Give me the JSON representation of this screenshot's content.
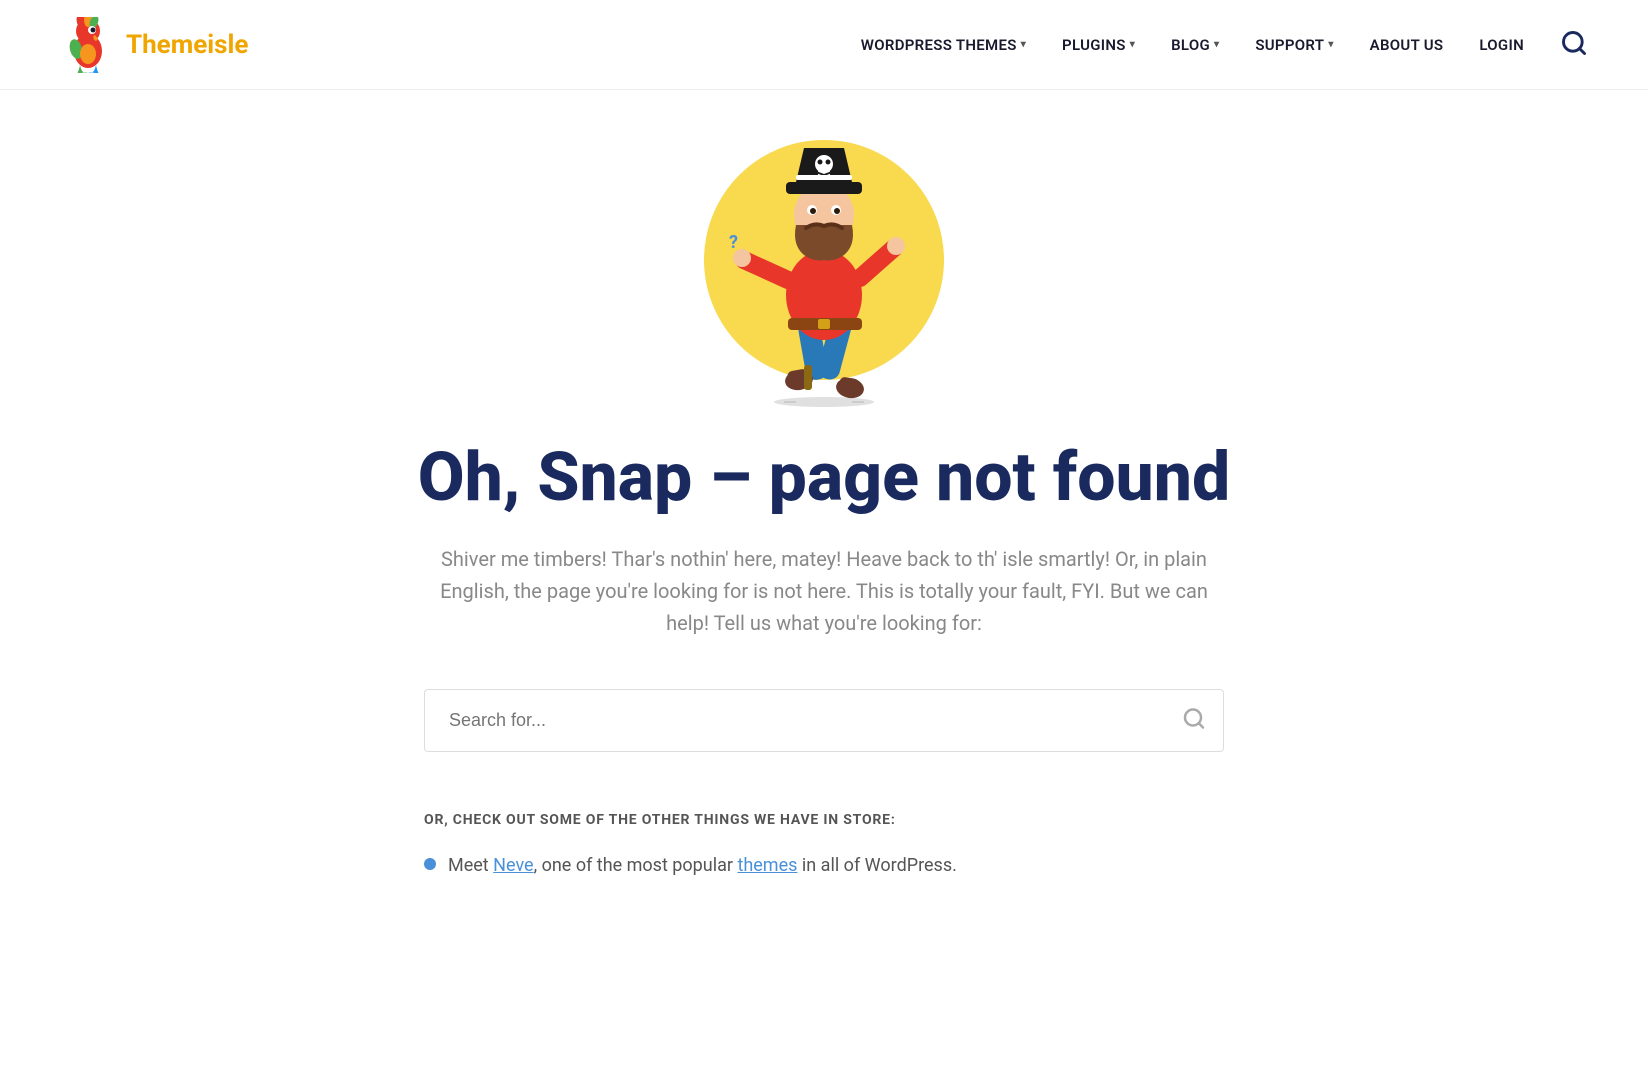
{
  "header": {
    "logo_name": "Themeisle",
    "logo_name_part1": "Theme",
    "logo_name_part2": "isle",
    "nav": {
      "items": [
        {
          "label": "WORDPRESS THEMES",
          "has_dropdown": true
        },
        {
          "label": "PLUGINS",
          "has_dropdown": true
        },
        {
          "label": "BLOG",
          "has_dropdown": true
        },
        {
          "label": "SUPPORT",
          "has_dropdown": true
        },
        {
          "label": "ABOUT US",
          "has_dropdown": false
        },
        {
          "label": "LOGIN",
          "has_dropdown": false
        }
      ]
    }
  },
  "main": {
    "error_heading": "Oh, Snap – page not found",
    "error_description": "Shiver me timbers! Thar's nothin' here, matey! Heave back to th' isle smartly! Or, in plain English, the page you're looking for is not here. This is totally your fault, FYI. But we can help! Tell us what you're looking for:",
    "search_placeholder": "Search for...",
    "more_info_label": "OR, CHECK OUT SOME OF THE OTHER THINGS WE HAVE IN STORE:",
    "bullet_item": {
      "text_before": "Meet ",
      "link1": "Neve",
      "text_middle": ", one of the most popular ",
      "link2": "themes",
      "text_after": " in all of WordPress."
    }
  }
}
